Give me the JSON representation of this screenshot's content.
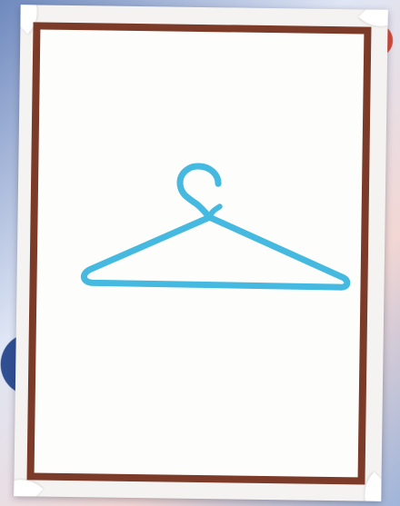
{
  "scene": {
    "subject": "hanger-icon",
    "colors": {
      "frame": "#7c3a28",
      "card": "#f5f3f1",
      "hanger": "#45b9e0"
    }
  }
}
